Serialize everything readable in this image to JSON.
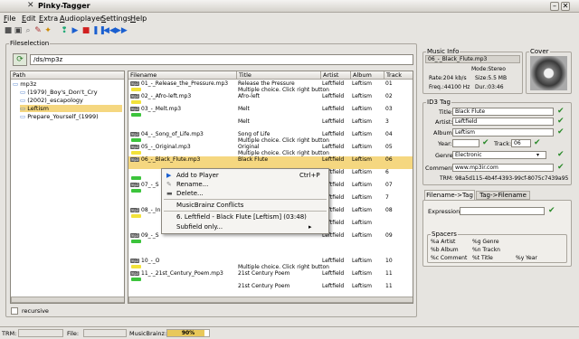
{
  "window": {
    "title": "Pinky-Tagger",
    "app_icon": "x-icon"
  },
  "menu": [
    "File",
    "Edit",
    "Extra",
    "Audioplayer",
    "Settings",
    "Help"
  ],
  "toolbar_icons": [
    "stop-icon",
    "floppy-icon",
    "zoom-icon",
    "wrench-icon",
    "magic-icon",
    "blank",
    "info-icon",
    "play-icon",
    "stop-red-icon",
    "pause-icon",
    "previous-icon",
    "next-icon"
  ],
  "fileselection": {
    "title": "Fileselection",
    "path": "/ds/mp3z",
    "tree_header": "Path",
    "tree": [
      "mp3z",
      "(1979)_Boy's_Don't_Cry",
      "(2002)_escapology",
      "Leftism",
      "Prepare_Yourself_(1999)"
    ],
    "recursive_label": "recursive"
  },
  "table": {
    "columns": [
      "Filename",
      "Title",
      "Artist",
      "Album",
      "Track"
    ],
    "rows": [
      {
        "file": "01_-_Release_the_Pressure.mp3",
        "title": "Release the Pressure",
        "artist": "Leftfield",
        "album": "Leftism",
        "track": "01",
        "note": "Multiple choice. Click right button",
        "tag": "yellow"
      },
      {
        "file": "02_-_Afro-left.mp3",
        "title": "Afro-left",
        "artist": "Leftfield",
        "album": "Leftism",
        "track": "02",
        "note": "",
        "tag": "yellow"
      },
      {
        "file": "03_-_Melt.mp3",
        "title": "Melt",
        "artist": "Leftfield",
        "album": "Leftism",
        "track": "03",
        "note": "",
        "tag": "green"
      },
      {
        "file": "",
        "title": "Melt",
        "artist": "Leftfield",
        "album": "Leftism",
        "track": "3",
        "note": "",
        "tag": "none"
      },
      {
        "file": "04_-_Song_of_Life.mp3",
        "title": "Song of Life",
        "artist": "Leftfield",
        "album": "Leftism",
        "track": "04",
        "note": "Multiple choice. Click right button",
        "tag": "green"
      },
      {
        "file": "05_-_Original.mp3",
        "title": "Original",
        "artist": "Leftfield",
        "album": "Leftism",
        "track": "05",
        "note": "Multiple choice. Click right button",
        "tag": "yellow"
      },
      {
        "file": "06_-_Black_Flute.mp3",
        "title": "Black Flute",
        "artist": "Leftfield",
        "album": "Leftism",
        "track": "06",
        "note": "",
        "tag": "selected"
      },
      {
        "file": "",
        "title": "",
        "artist": "Leftfield",
        "album": "Leftism",
        "track": "6",
        "note": "",
        "tag": "green"
      },
      {
        "file": "07_-_S",
        "title": "",
        "artist": "Leftfield",
        "album": "Leftism",
        "track": "07",
        "note": "",
        "tag": "green"
      },
      {
        "file": "",
        "title": "",
        "artist": "Leftfield",
        "album": "Leftism",
        "track": "7",
        "note": "",
        "tag": "none"
      },
      {
        "file": "08_-_In",
        "title": "",
        "artist": "Leftfield",
        "album": "Leftism",
        "track": "08",
        "note": "",
        "tag": "yellow"
      },
      {
        "file": "",
        "title": "",
        "artist": "Leftfield",
        "album": "Leftism",
        "track": "",
        "note": "",
        "tag": "none"
      },
      {
        "file": "09_-_S",
        "title": "",
        "artist": "Leftfield",
        "album": "Leftism",
        "track": "09",
        "note": "",
        "tag": "green"
      },
      {
        "file": "",
        "title": "",
        "artist": "",
        "album": "",
        "track": "",
        "note": "",
        "tag": "none"
      },
      {
        "file": "10_-_O",
        "title": "",
        "artist": "Leftfield",
        "album": "Leftism",
        "track": "10",
        "note": "Multiple choice. Click right button",
        "tag": "yellow"
      },
      {
        "file": "11_-_21st_Century_Poem.mp3",
        "title": "21st Century Poem",
        "artist": "Leftfield",
        "album": "Leftism",
        "track": "11",
        "note": "",
        "tag": "green"
      },
      {
        "file": "",
        "title": "21st Century Poem",
        "artist": "Leftfield",
        "album": "Leftism",
        "track": "11",
        "note": "",
        "tag": "none"
      }
    ]
  },
  "context_menu": {
    "items": [
      {
        "label": "Add to Player",
        "shortcut": "Ctrl+P",
        "icon": "play-icon"
      },
      {
        "label": "Rename...",
        "shortcut": "",
        "icon": "pencil-icon"
      },
      {
        "label": "Delete...",
        "shortcut": "",
        "icon": "trash-icon"
      }
    ],
    "section": "MusicBrainz Conflicts",
    "conflict": "6. Leftfield - Black Flute [Leftism] (03:48)",
    "submenu": "Subfield only..."
  },
  "music_info": {
    "title": "Music Info",
    "filename": "06_-_Black_Flute.mp3",
    "mode": "Mode:Stereo",
    "rate": "Rate:204 kb/s",
    "size": "Size:5.5 MB",
    "freq": "Freq.:44100 Hz",
    "dur": "Dur.:03:46",
    "cover_title": "Cover"
  },
  "id3": {
    "title": "ID3 Tag",
    "title_label": "Title:",
    "title_value": "Black Flute",
    "artist_label": "Artist:",
    "artist_value": "Leftfield",
    "album_label": "Album:",
    "album_value": "Leftism",
    "year_label": "Year:",
    "year_value": "",
    "track_label": "Track:",
    "track_value": "06",
    "genre_label": "Genre:",
    "genre_value": "Electronic",
    "comment_label": "Comment:",
    "comment_value": "www.mp3ir.com",
    "trm": "TRM: 98a5d115-4b4f-4393-99cf-8075c7439a95"
  },
  "tabs": [
    "Filename->Tag",
    "Tag->Filename"
  ],
  "expression": {
    "label": "Expression:",
    "value": ""
  },
  "spacers": {
    "title": "Spacers",
    "items": [
      "%a Artist",
      "%g Genre",
      "%b Album",
      "%n Trackn",
      "%c Comment",
      "%t Title",
      "%y Year"
    ]
  },
  "status": {
    "trm_label": "TRM:",
    "file_label": "File:",
    "mb_label": "MusicBrainz:",
    "progress_text": "90%",
    "progress": 0.9
  }
}
